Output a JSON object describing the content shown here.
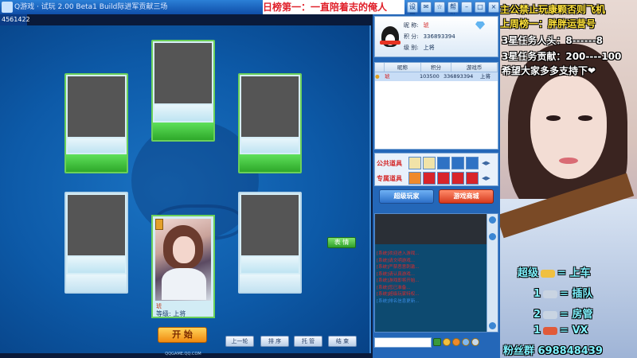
{
  "window": {
    "title": "Q游戏 · 试玩 2.00 Beta1 Build际进军贡献三场",
    "sub_id": "4561422",
    "banner": "日榜第一：一直陪着志的俺人",
    "top_buttons": [
      "设置",
      "✉",
      "☆",
      "帮助",
      "–",
      "□",
      "×"
    ]
  },
  "me": {
    "name": "琥",
    "rank_label": "等级:",
    "rank_value": "上将"
  },
  "table": {
    "emote_button": "表 情",
    "start_button": "开 始",
    "bottom_buttons": [
      "上一轮",
      "排 序",
      "托 管",
      "结 束"
    ],
    "footer_url": "QQGAME.QQ.COM"
  },
  "profile": {
    "nickname_label": "昵 称:",
    "nickname": "琥",
    "score_label": "积 分:",
    "score": "336893394",
    "level_label": "级 别:",
    "level": "上将"
  },
  "players": {
    "headers": [
      "昵称",
      "积分",
      "游戏币"
    ],
    "rows": [
      {
        "name": "琥",
        "score": "103500",
        "coins": "336893394",
        "extra": "上将"
      }
    ]
  },
  "props": {
    "public_label": "公共道具",
    "private_label": "专属道具"
  },
  "vip": {
    "super_player": "超级玩家",
    "mall": "游戏商城"
  },
  "chat": {
    "lines": [
      "[系统]欢迎进入游戏...",
      "[系统]请文明游戏...",
      "[系统]严禁恶意刺激...",
      "[系统]请认真游戏...",
      "[系统]游戏即将开始...",
      "[系统]您已准备...",
      "[系统]超级玩家特权...",
      "[系统]排名信息更新..."
    ]
  },
  "overlay": {
    "line1": "主公禁止玩康颗否则飞机",
    "line2": "上周榜一：胖胖运营号",
    "line3": "3星任务人头：8------8",
    "line4": "3星任务贡献：200----100",
    "line5": "希望大家多多支持下",
    "rank_rows": [
      {
        "left": "超级",
        "right": "上车"
      },
      {
        "left": "1",
        "right": "插队"
      },
      {
        "left": "2",
        "right": "房管"
      },
      {
        "left": "1",
        "right": "VX"
      }
    ],
    "equals": "=",
    "fan_group": "粉丝群 698848439"
  }
}
